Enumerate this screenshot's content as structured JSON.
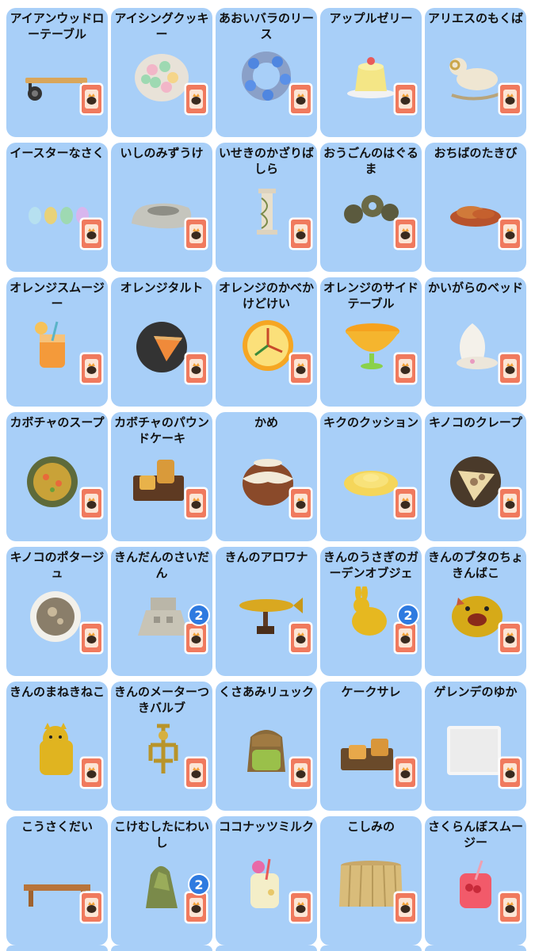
{
  "icon": "recipe-card-icon",
  "colors": {
    "card_bg": "#a8cff8",
    "recipe_card": "#f07a5e",
    "recipe_inner": "#fce5d5",
    "badge_bg": "#2e7ae0"
  },
  "items": [
    {
      "name": "アイアンウッドローテーブル",
      "art": "table"
    },
    {
      "name": "アイシングクッキー",
      "art": "cookies"
    },
    {
      "name": "あおいバラのリース",
      "art": "wreath"
    },
    {
      "name": "アップルゼリー",
      "art": "jelly"
    },
    {
      "name": "アリエスのもくば",
      "art": "ram"
    },
    {
      "name": "イースターなさく",
      "art": "eggs"
    },
    {
      "name": "いしのみずうけ",
      "art": "stone"
    },
    {
      "name": "いせきのかざりばしら",
      "art": "pillar"
    },
    {
      "name": "おうごんのはぐるま",
      "art": "gears"
    },
    {
      "name": "おちばのたきび",
      "art": "leaves"
    },
    {
      "name": "オレンジスムージー",
      "art": "smoothie"
    },
    {
      "name": "オレンジタルト",
      "art": "tart"
    },
    {
      "name": "オレンジのかべかけどけい",
      "art": "clock"
    },
    {
      "name": "オレンジのサイドテーブル",
      "art": "orangetable"
    },
    {
      "name": "かいがらのベッド",
      "art": "shell"
    },
    {
      "name": "カボチャのスープ",
      "art": "soup"
    },
    {
      "name": "カボチャのパウンドケーキ",
      "art": "cake"
    },
    {
      "name": "かめ",
      "art": "pot"
    },
    {
      "name": "キクのクッション",
      "art": "flower"
    },
    {
      "name": "キノコのクレープ",
      "art": "crepe"
    },
    {
      "name": "キノコのポタージュ",
      "art": "potage"
    },
    {
      "name": "きんだんのさいだん",
      "art": "altar",
      "badge": "2"
    },
    {
      "name": "きんのアロワナ",
      "art": "fish"
    },
    {
      "name": "きんのうさぎのガーデンオブジェ",
      "art": "rabbit",
      "badge": "2"
    },
    {
      "name": "きんのブタのちょきんばこ",
      "art": "pig"
    },
    {
      "name": "きんのまねきねこ",
      "art": "cat"
    },
    {
      "name": "きんのメーターつきバルブ",
      "art": "valve"
    },
    {
      "name": "くさあみリュック",
      "art": "backpack"
    },
    {
      "name": "ケークサレ",
      "art": "cakesale"
    },
    {
      "name": "ゲレンデのゆか",
      "art": "snow"
    },
    {
      "name": "こうさくだい",
      "art": "workbench"
    },
    {
      "name": "こけむしたにわいし",
      "art": "mossrock",
      "badge": "2"
    },
    {
      "name": "ココナッツミルク",
      "art": "coconut"
    },
    {
      "name": "こしみの",
      "art": "skirt"
    },
    {
      "name": "さくらんぼスムージー",
      "art": "cherry"
    }
  ]
}
